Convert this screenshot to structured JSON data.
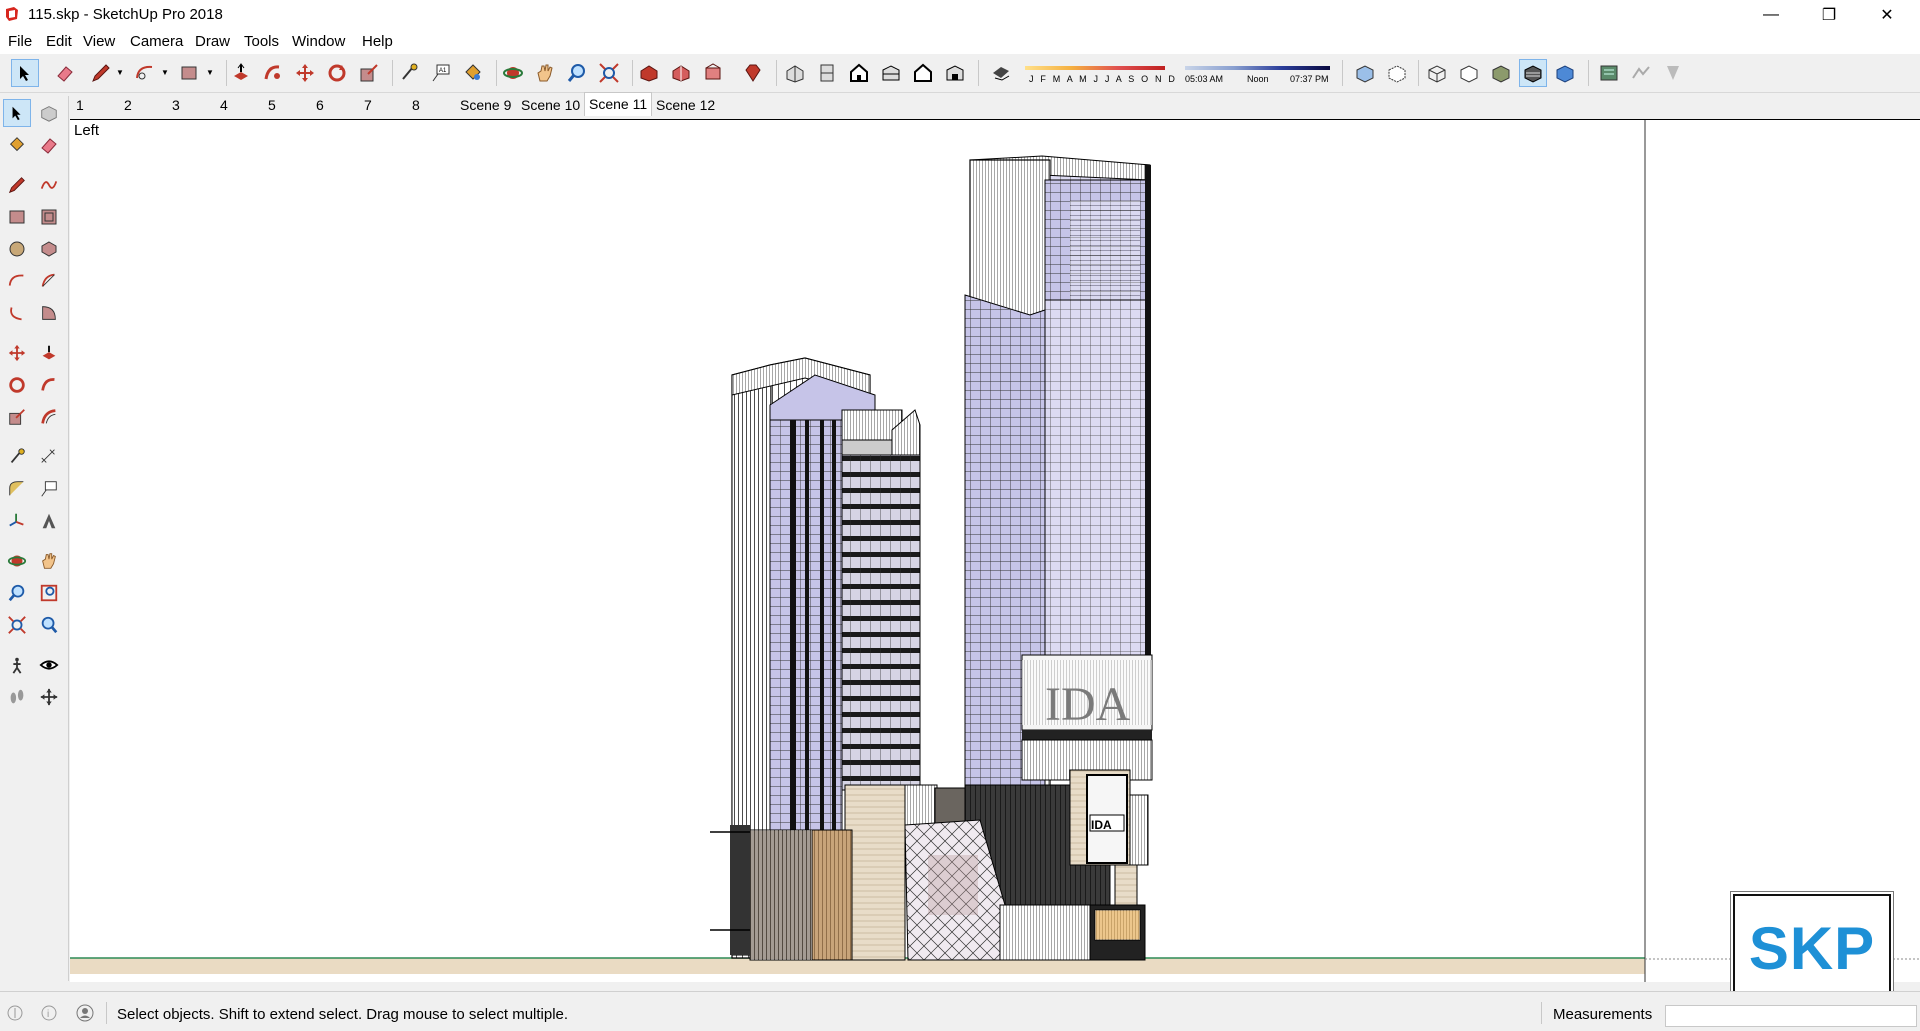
{
  "window": {
    "title": "115.skp - SketchUp Pro 2018",
    "app_icon": "sketchup-icon",
    "controls": {
      "minimize": "—",
      "maximize": "❐",
      "close": "✕"
    }
  },
  "menu": {
    "items": [
      "File",
      "Edit",
      "View",
      "Camera",
      "Draw",
      "Tools",
      "Window",
      "Help"
    ]
  },
  "shadow_settings": {
    "months": "J F M A M J J A S O N D",
    "time_start": "05:03 AM",
    "time_noon": "Noon",
    "time_end": "07:37 PM"
  },
  "scenes": {
    "tabs": [
      "1",
      "2",
      "3",
      "4",
      "5",
      "6",
      "7",
      "8",
      "Scene 9",
      "Scene 10",
      "Scene 11",
      "Scene 12"
    ],
    "active": "Scene 11"
  },
  "viewport": {
    "view_label": "Left",
    "ground_color": "#eadbc3",
    "horizon_color": "#2e8b57"
  },
  "status": {
    "hint": "Select objects. Shift to extend select. Drag mouse to select multiple.",
    "measurements_label": "Measurements",
    "measurements_value": ""
  },
  "logo": {
    "text": "SKP",
    "color": "#1e90d6"
  },
  "building_sign": "IDA"
}
